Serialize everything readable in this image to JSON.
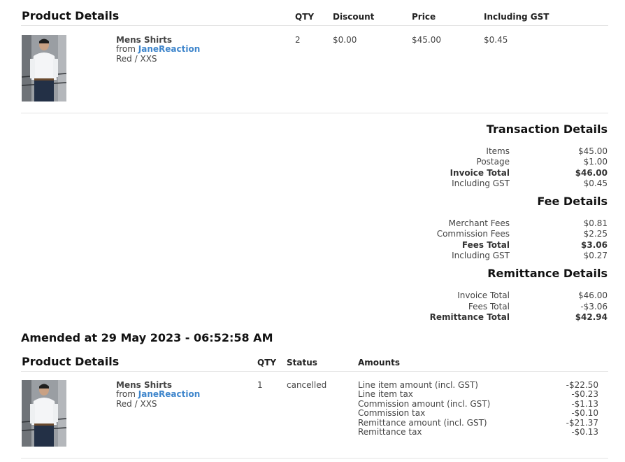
{
  "order": {
    "section_title": "Product Details",
    "columns": {
      "qty": "QTY",
      "discount": "Discount",
      "price": "Price",
      "gst": "Including GST"
    },
    "item": {
      "name": "Mens Shirts",
      "from_prefix": "from",
      "vendor": "JaneReaction",
      "variant": "Red / XXS",
      "qty": "2",
      "discount": "$0.00",
      "price": "$45.00",
      "gst": "$0.45"
    }
  },
  "transaction": {
    "title": "Transaction Details",
    "rows": [
      {
        "label": "Items",
        "value": "$45.00"
      },
      {
        "label": "Postage",
        "value": "$1.00"
      },
      {
        "label": "Invoice Total",
        "value": "$46.00"
      },
      {
        "label": "Including GST",
        "value": "$0.45"
      }
    ]
  },
  "fees": {
    "title": "Fee Details",
    "rows": [
      {
        "label": "Merchant Fees",
        "value": "$0.81"
      },
      {
        "label": "Commission Fees",
        "value": "$2.25"
      },
      {
        "label": "Fees Total",
        "value": "$3.06"
      },
      {
        "label": "Including GST",
        "value": "$0.27"
      }
    ]
  },
  "remittance": {
    "title": "Remittance Details",
    "rows": [
      {
        "label": "Invoice Total",
        "value": "$46.00"
      },
      {
        "label": "Fees Total",
        "value": "-$3.06"
      },
      {
        "label": "Remittance Total",
        "value": "$42.94"
      }
    ]
  },
  "amendment": {
    "title": "Amended at 29 May 2023 - 06:52:58 AM",
    "section_title": "Product Details",
    "columns": {
      "qty": "QTY",
      "status": "Status",
      "amounts": "Amounts"
    },
    "item": {
      "name": "Mens Shirts",
      "from_prefix": "from",
      "vendor": "JaneReaction",
      "variant": "Red / XXS",
      "qty": "1",
      "status": "cancelled"
    },
    "amounts": [
      {
        "label": "Line item amount (incl. GST)",
        "value": "-$22.50"
      },
      {
        "label": "Line item tax",
        "value": "-$0.23"
      },
      {
        "label": "Commission amount (incl. GST)",
        "value": "-$1.13"
      },
      {
        "label": "Commission tax",
        "value": "-$0.10"
      },
      {
        "label": "Remittance amount (incl. GST)",
        "value": "-$21.37"
      },
      {
        "label": "Remittance tax",
        "value": "-$0.13"
      }
    ]
  }
}
